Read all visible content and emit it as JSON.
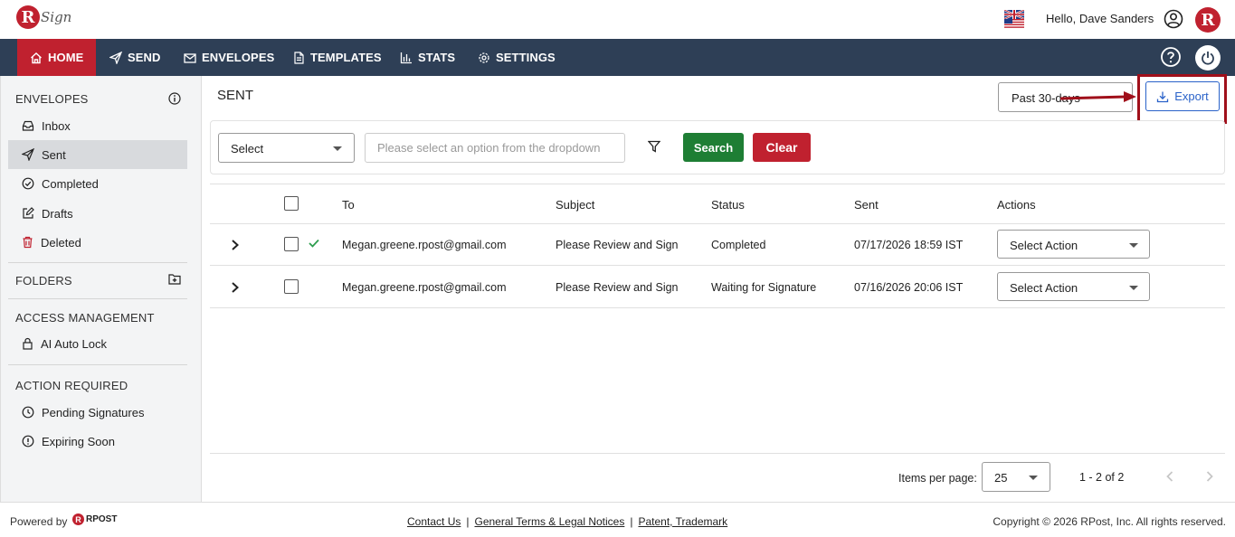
{
  "header": {
    "logo_letter": "R",
    "logo_text": "Sign",
    "greeting": "Hello, Dave Sanders",
    "brand_letter": "R"
  },
  "nav": {
    "items": [
      {
        "label": "HOME",
        "icon": "home-icon",
        "active": true
      },
      {
        "label": "SEND",
        "icon": "send-icon"
      },
      {
        "label": "ENVELOPES",
        "icon": "envelope-icon"
      },
      {
        "label": "TEMPLATES",
        "icon": "document-icon"
      },
      {
        "label": "STATS",
        "icon": "bar-chart-icon"
      },
      {
        "label": "SETTINGS",
        "icon": "gear-icon"
      }
    ]
  },
  "sidebar": {
    "envelopes_title": "ENVELOPES",
    "envelope_items": [
      {
        "label": "Inbox",
        "icon": "inbox-icon"
      },
      {
        "label": "Sent",
        "icon": "send-icon",
        "active": true
      },
      {
        "label": "Completed",
        "icon": "check-circle-icon"
      },
      {
        "label": "Drafts",
        "icon": "edit-icon"
      },
      {
        "label": "Deleted",
        "icon": "trash-icon"
      }
    ],
    "folders_title": "FOLDERS",
    "access_title": "ACCESS MANAGEMENT",
    "access_items": [
      {
        "label": "AI Auto Lock",
        "icon": "lock-icon"
      }
    ],
    "action_title": "ACTION REQUIRED",
    "action_items": [
      {
        "label": "Pending Signatures",
        "icon": "clock-icon"
      },
      {
        "label": "Expiring Soon",
        "icon": "alert-icon"
      }
    ]
  },
  "main": {
    "title": "SENT",
    "date_range": "Past 30-days",
    "export_label": "Export",
    "filter": {
      "select_value": "Select",
      "search_placeholder": "Please select an option from the dropdown",
      "search_label": "Search",
      "clear_label": "Clear"
    },
    "table": {
      "columns": [
        "To",
        "Subject",
        "Status",
        "Sent",
        "Actions"
      ],
      "rows": [
        {
          "to": "Megan.greene.rpost@gmail.com",
          "subject": "Please Review and Sign",
          "status": "Completed",
          "sent": "07/17/2026 18:59 IST",
          "action": "Select Action",
          "completed": true
        },
        {
          "to": "Megan.greene.rpost@gmail.com",
          "subject": "Please Review and Sign",
          "status": "Waiting for Signature",
          "sent": "07/16/2026 20:06 IST",
          "action": "Select Action",
          "completed": false
        }
      ]
    },
    "pager": {
      "items_per_page_label": "Items per page:",
      "items_per_page": "25",
      "range": "1 - 2 of 2"
    }
  },
  "footer": {
    "powered_by": "Powered by",
    "rpost_letter": "R",
    "rpost_text": "RPOST",
    "links": [
      "Contact Us",
      "General Terms & Legal Notices",
      "Patent, Trademark"
    ],
    "copyright": "Copyright © 2026 RPost, Inc. All rights reserved."
  },
  "colors": {
    "nav_bg": "#2e3f56",
    "accent_red": "#c0212f",
    "search_green": "#1e7e34",
    "export_blue": "#2a62c9"
  }
}
